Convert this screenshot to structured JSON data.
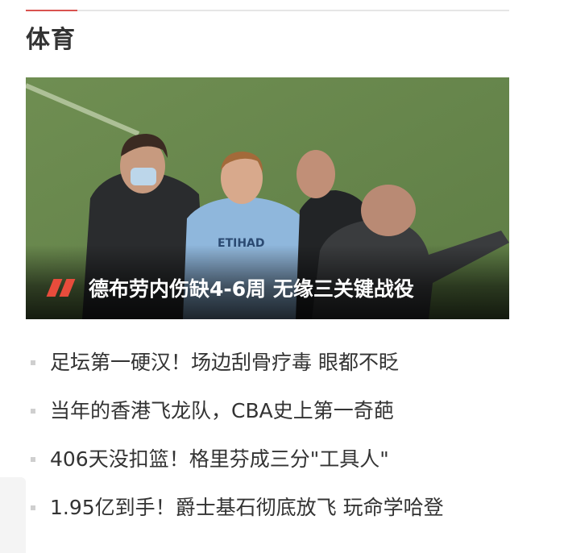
{
  "section": {
    "title": "体育"
  },
  "hero": {
    "title": "德布劳内伤缺4-6周 无缘三关键战役",
    "image": "soccer-sideline-photo",
    "accent_color": "#e74c3c"
  },
  "news": [
    {
      "title": "足坛第一硬汉！场边刮骨疗毒 眼都不眨"
    },
    {
      "title": "当年的香港飞龙队，CBA史上第一奇葩"
    },
    {
      "title": "406天没扣篮！格里芬成三分\"工具人\""
    },
    {
      "title": "1.95亿到手！爵士基石彻底放飞 玩命学哈登"
    }
  ],
  "colors": {
    "accent": "#d9534f",
    "text": "#333333",
    "bullet": "#cfcfcf"
  }
}
